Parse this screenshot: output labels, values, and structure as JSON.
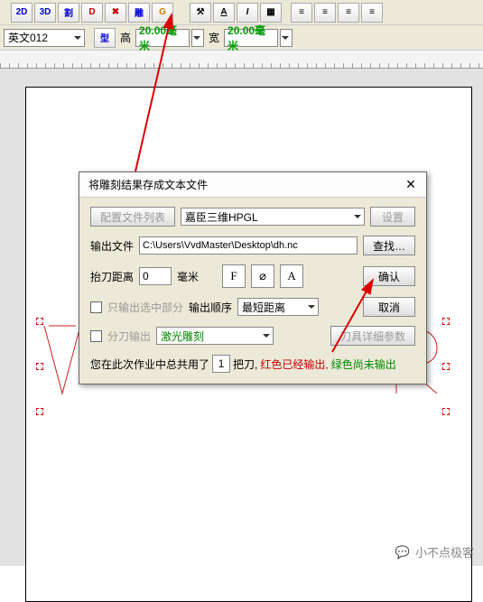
{
  "toolbar1": {
    "b2d": "2D",
    "b3d": "3D",
    "cut": "割",
    "d": "D",
    "x": "✖",
    "carve": "雕",
    "g": "G",
    "hammer": "⚒",
    "a_u": "A",
    "i": "I",
    "grp": "▦",
    "al1": "≡",
    "al2": "≡",
    "al3": "≡",
    "al4": "≡"
  },
  "toolbar2": {
    "font": "英文012",
    "type": "型",
    "hlabel": "高",
    "hval": "20.00毫米",
    "wlabel": "宽",
    "wval": "20.00毫米"
  },
  "dialog": {
    "title": "将雕刻结果存成文本文件",
    "cfg_list": "配置文件列表",
    "cfg_val": "嘉臣三维HPGL",
    "settings": "设置",
    "out_label": "输出文件",
    "out_path": "C:\\Users\\VvdMaster\\Desktop\\dh.nc",
    "find": "查找…",
    "lift_label": "抬刀距离",
    "lift_val": "0",
    "lift_unit": "毫米",
    "iconF": "F",
    "iconG": "⌀",
    "iconA": "A",
    "ok": "确认",
    "cancel": "取消",
    "only_sel": "只输出选中部分",
    "order_label": "输出顺序",
    "order_val": "最短距离",
    "split": "分刀输出",
    "laser": "激光雕刻",
    "tool_params": "刀具详细参数",
    "sentence_a": "您在此次作业中总共用了",
    "count": "1",
    "sentence_b": "把刀,",
    "sentence_c": "红色已经输出,",
    "sentence_d": "绿色尚未输出"
  },
  "watermark": "小不点极客"
}
